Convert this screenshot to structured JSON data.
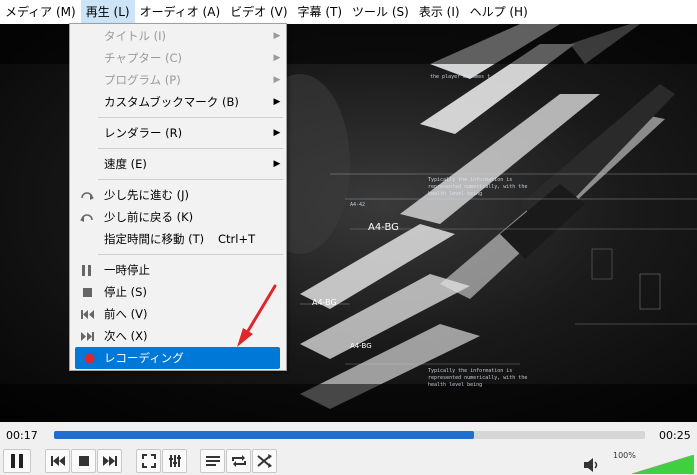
{
  "menubar": [
    "メディア (M)",
    "再生 (L)",
    "オーディオ (A)",
    "ビデオ (V)",
    "字幕 (T)",
    "ツール (S)",
    "表示 (I)",
    "ヘルプ (H)"
  ],
  "menubar_active_index": 1,
  "popup": {
    "items": [
      {
        "icon": "",
        "label": "タイトル (I)",
        "shortcut": "",
        "submenu": true,
        "disabled": true
      },
      {
        "icon": "",
        "label": "チャプター (C)",
        "shortcut": "",
        "submenu": true,
        "disabled": true
      },
      {
        "icon": "",
        "label": "プログラム (P)",
        "shortcut": "",
        "submenu": true,
        "disabled": true
      },
      {
        "icon": "",
        "label": "カスタムブックマーク (B)",
        "shortcut": "",
        "submenu": true,
        "disabled": false
      },
      {
        "sep": true
      },
      {
        "icon": "",
        "label": "レンダラー (R)",
        "shortcut": "",
        "submenu": true,
        "disabled": false
      },
      {
        "sep": true
      },
      {
        "icon": "",
        "label": "速度 (E)",
        "shortcut": "",
        "submenu": true,
        "disabled": false
      },
      {
        "sep": true
      },
      {
        "icon": "step-forward-icon",
        "label": "少し先に進む (J)",
        "shortcut": "",
        "submenu": false,
        "disabled": false
      },
      {
        "icon": "step-back-icon",
        "label": "少し前に戻る (K)",
        "shortcut": "",
        "submenu": false,
        "disabled": false
      },
      {
        "icon": "",
        "label": "指定時間に移動 (T)",
        "shortcut": "Ctrl+T",
        "submenu": false,
        "disabled": false
      },
      {
        "sep": true
      },
      {
        "icon": "pause-icon",
        "label": "一時停止",
        "shortcut": "",
        "submenu": false,
        "disabled": false
      },
      {
        "icon": "stop-icon",
        "label": "停止 (S)",
        "shortcut": "",
        "submenu": false,
        "disabled": false
      },
      {
        "icon": "previous-icon",
        "label": "前へ (V)",
        "shortcut": "",
        "submenu": false,
        "disabled": false
      },
      {
        "icon": "next-icon",
        "label": "次へ (X)",
        "shortcut": "",
        "submenu": false,
        "disabled": false
      },
      {
        "icon": "record-icon",
        "label": "レコーディング",
        "shortcut": "",
        "submenu": false,
        "disabled": false,
        "selected": true
      }
    ]
  },
  "video_overlay": {
    "big_labels": [
      "A4-BG",
      "A4-BG",
      "A4-BG"
    ],
    "text_lines": [
      "the player becomes t",
      "Typically the information is",
      "represented numerically, with the",
      "health level being",
      "Typically the information is",
      "represented numerically, with the",
      "health level being",
      "A4-42"
    ]
  },
  "player": {
    "elapsed": "00:17",
    "total": "00:25",
    "progress": 0.71,
    "volume_text": "100%",
    "volume": 1.0
  },
  "colors": {
    "accent": "#0078d7",
    "seek_fill": "#1e6fd1",
    "volume_fill": "#3fcf3f",
    "annotation": "#e0262a"
  }
}
